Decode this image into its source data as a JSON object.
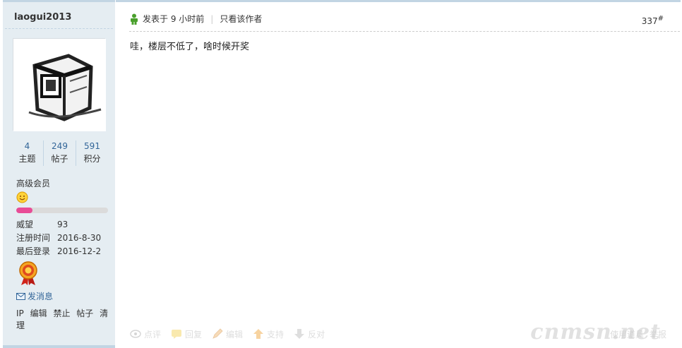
{
  "author": {
    "username": "laogui2013",
    "stats": [
      {
        "value": "4",
        "label": "主题"
      },
      {
        "value": "249",
        "label": "帖子"
      },
      {
        "value": "591",
        "label": "积分"
      }
    ],
    "level": "高级会员",
    "level_progress": 0.18,
    "info": [
      {
        "key": "威望",
        "value": "93"
      },
      {
        "key": "注册时间",
        "value": "2016-8-30"
      },
      {
        "key": "最后登录",
        "value": "2016-12-2"
      }
    ],
    "send_message": "发消息",
    "admin_links": [
      "IP",
      "编辑",
      "禁止",
      "帖子",
      "清理"
    ]
  },
  "post": {
    "posted_time": "发表于 9 小时前",
    "author_only": "只看该作者",
    "floor_number": "337",
    "floor_mark": "#",
    "content": "哇，楼层不低了，啥时候开奖"
  },
  "actions": [
    {
      "label": "点评",
      "icon": "comment-icon"
    },
    {
      "label": "回复",
      "icon": "reply-icon"
    },
    {
      "label": "编辑",
      "icon": "edit-icon"
    },
    {
      "label": "支持",
      "icon": "support-icon"
    },
    {
      "label": "反对",
      "icon": "oppose-icon"
    }
  ],
  "bottom_right": [
    "使用道具",
    "举报"
  ],
  "watermark": "cnmsn.net",
  "colors": {
    "sidebar_bg": "#e5edf2",
    "border": "#c2d5e3",
    "link": "#336699",
    "progress": "#e84c97"
  }
}
